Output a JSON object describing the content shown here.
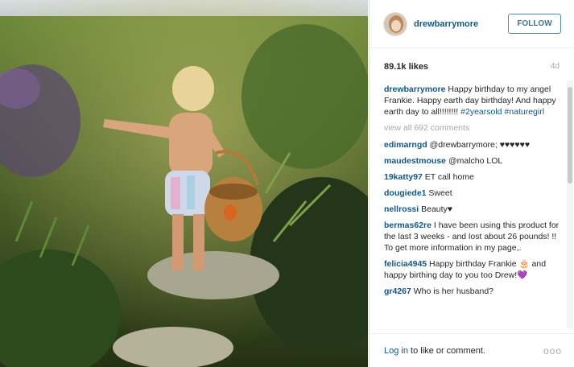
{
  "post": {
    "username": "drewbarrymore",
    "follow_label": "FOLLOW",
    "likes": "89.1k likes",
    "age": "4d"
  },
  "caption": {
    "user": "drewbarrymore",
    "text": " Happy birthday to my angel Frankie. Happy earth day birthday! And happy earth day to all!!!!!!!! ",
    "tags": "#2yearsold #naturegirl"
  },
  "view_all": "view all 692 comments",
  "comments": [
    {
      "user": "edimarngd",
      "text": " @drewbarrymore; ♥♥♥♥♥♥"
    },
    {
      "user": "maudestmouse",
      "text": " @malcho LOL"
    },
    {
      "user": "19katty97",
      "text": " ET call home"
    },
    {
      "user": "dougiede1",
      "text": " Sweet"
    },
    {
      "user": "nellrossi",
      "text": " Beauty♥"
    },
    {
      "user": "bermas62re",
      "text": " I have been using this product for the last 3 weeks - and lost about 26 pounds! !! To get more information in my page,."
    },
    {
      "user": "felicia4945",
      "text": " Happy birthday Frankie 🎂 and happy birthing day to you too Drew!💜"
    },
    {
      "user": "gr4267",
      "text": " Who is her husband?"
    }
  ],
  "footer": {
    "login_link": "Log in",
    "login_text": " to like or comment.",
    "more": "ooo"
  },
  "colors": {
    "link_blue": "#125688",
    "follow_border": "#4a8bc2",
    "muted": "#a5a7aa"
  }
}
